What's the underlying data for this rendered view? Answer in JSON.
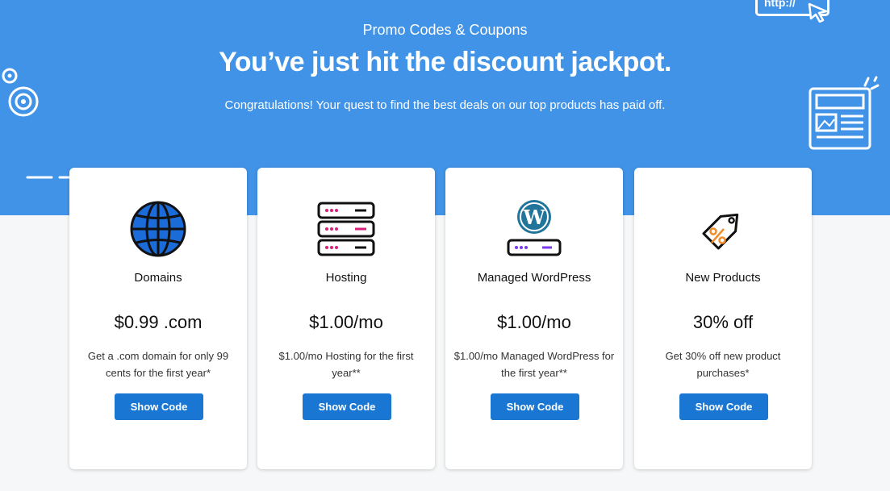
{
  "header": {
    "eyebrow": "Promo Codes & Coupons",
    "headline": "You’ve just hit the discount jackpot.",
    "subtext": "Congratulations! Your quest to find the best deals on our top products has paid off.",
    "url_badge": "http://"
  },
  "colors": {
    "hero_bg": "#4193e8",
    "button": "#1976d2",
    "accent_pink": "#d6207a",
    "accent_orange": "#f28c28",
    "wordpress": "#21759b"
  },
  "cards": [
    {
      "icon": "globe-icon",
      "title": "Domains",
      "price": "$0.99 .com",
      "description": "Get a .com domain for only 99 cents for the first year*",
      "button_label": "Show Code"
    },
    {
      "icon": "server-icon",
      "title": "Hosting",
      "price": "$1.00/mo",
      "description": "$1.00/mo Hosting for the first year**",
      "button_label": "Show Code"
    },
    {
      "icon": "wordpress-icon",
      "title": "Managed WordPress",
      "price": "$1.00/mo",
      "description": "$1.00/mo Managed WordPress for the first year**",
      "button_label": "Show Code"
    },
    {
      "icon": "price-tag-icon",
      "title": "New Products",
      "price": "30% off",
      "description": "Get 30% off new product purchases*",
      "button_label": "Show Code"
    }
  ]
}
